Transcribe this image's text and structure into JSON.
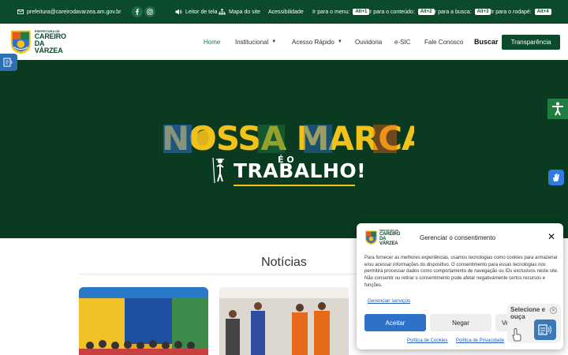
{
  "topbar": {
    "email": "prefeitura@careirodavarzea.am.gov.br",
    "links": {
      "screen_reader": "Leitor de tela",
      "sitemap": "Mapa do site",
      "accessibility": "Acessibilidade",
      "go_menu": "Ir para o menu:",
      "go_menu_key": "Alt+1",
      "go_content": "Ir para o conteúdo:",
      "go_content_key": "Alt+2",
      "go_search": "Ir para a busca:",
      "go_search_key": "Alt+3",
      "go_footer": "Ir para o rodapé:",
      "go_footer_key": "Alt+4"
    }
  },
  "header": {
    "logo_small": "PREFEITURA DE",
    "logo_line1": "CAREIRO",
    "logo_line2": "DA VÁRZEA",
    "nav": [
      "Home",
      "Institucional",
      "Acesso Rápido",
      "Ouvidoria",
      "e-SIC",
      "Fale Conosco"
    ],
    "search_label": "Buscar",
    "transparency_label": "Transparência"
  },
  "hero": {
    "headline": "NOSSA MARCA",
    "eo": "É O",
    "subline": "TRABALHO!"
  },
  "news": {
    "title": "Notícias"
  },
  "consent": {
    "logo_small": "PREFEITURA DE",
    "logo_line1": "CAREIRO",
    "logo_line2": "DA VÁRZEA",
    "title": "Gerenciar o consentimento",
    "body": "Para fornecer as melhores experiências, usamos tecnologias como cookies para armazenar e/ou acessar informações do dispositivo. O consentimento para essas tecnologias nos permitirá processar dados como comportamento de navegação ou IDs exclusivos neste site. Não consentir ou retirar o consentimento pode afetar negativamente certos recursos e funções.",
    "manage_link": "Gerenciar serviços",
    "accept": "Aceitar",
    "deny": "Negar",
    "preferences": "Ve",
    "cookie_policy": "Política de Cookies",
    "privacy_policy": "Política de Privacidade"
  },
  "tts": {
    "label": "Selecione e ouça"
  },
  "colors": {
    "brand_green": "#0b4a2b",
    "hero_bg": "#0a3a20",
    "accent_yellow": "#f3c21a",
    "accept_blue": "#2f70c8",
    "accessibility_green": "#1f7d40"
  }
}
